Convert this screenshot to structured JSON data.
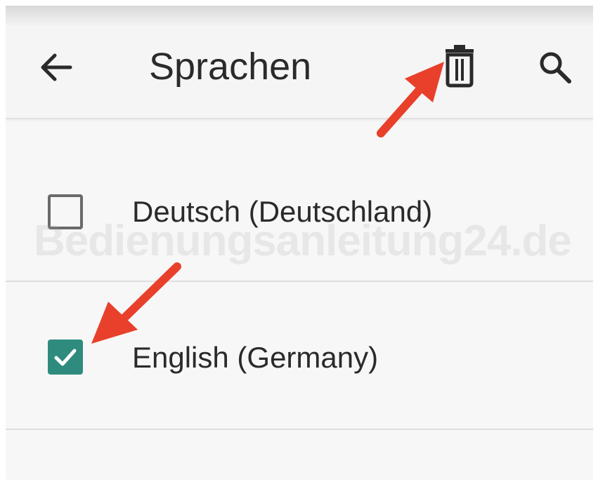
{
  "appbar": {
    "title": "Sprachen",
    "back_icon": "arrow-back-icon",
    "delete_icon": "trash-icon",
    "search_icon": "search-icon"
  },
  "languages": [
    {
      "label": "Deutsch (Deutschland)",
      "checked": false
    },
    {
      "label": "English (Germany)",
      "checked": true
    }
  ],
  "watermark": "Bedienungsanleitung24.de",
  "colors": {
    "accent": "#2e8b7e",
    "annotation_arrow": "#e8402a",
    "text": "#2a2a2a",
    "background": "#f7f7f7"
  }
}
